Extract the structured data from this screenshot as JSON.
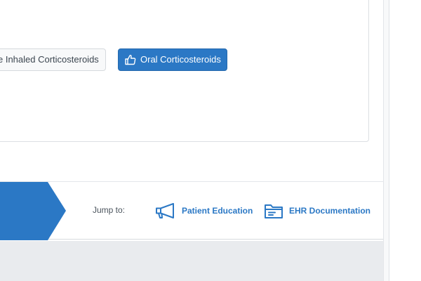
{
  "options": {
    "inhaled_label": "e Inhaled Corticosteroids",
    "oral_label": "Oral Corticosteroids",
    "oral_icon": "thumbs-up-icon"
  },
  "footer": {
    "jump_label": "Jump to:",
    "links": [
      {
        "label": "Patient Education",
        "icon": "megaphone-icon"
      },
      {
        "label": "EHR Documentation",
        "icon": "folder-icon"
      }
    ]
  },
  "colors": {
    "accent": "#2b78c5",
    "selected_button": "#2b78c5",
    "page_background_lower": "#e9ebee"
  }
}
